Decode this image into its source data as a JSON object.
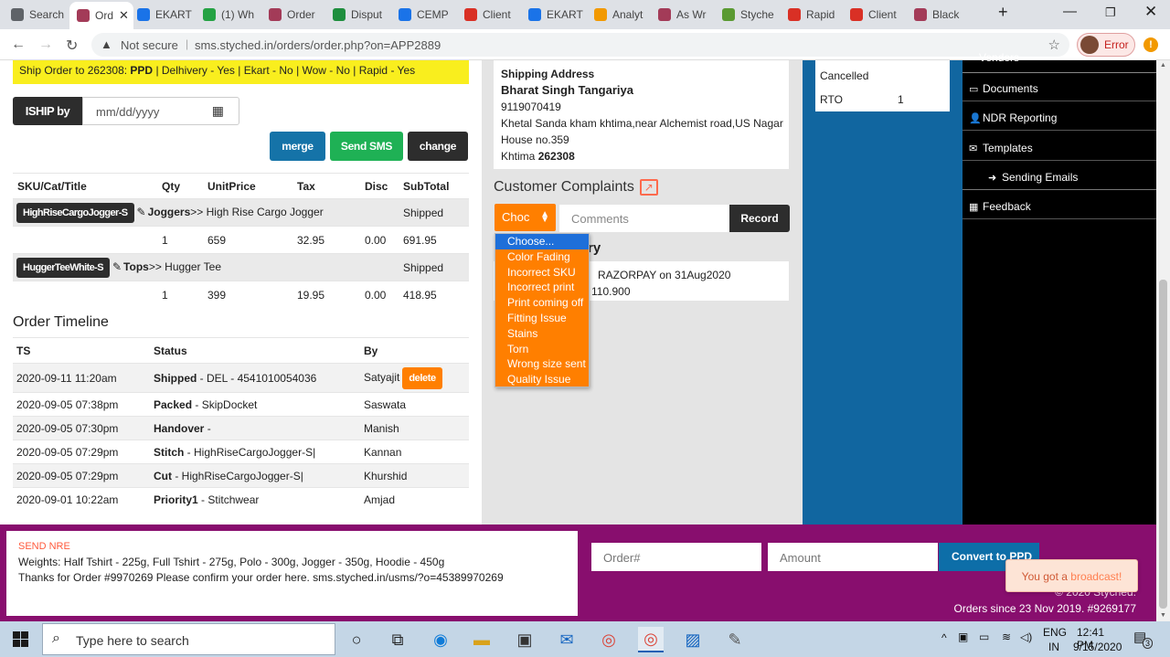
{
  "browser": {
    "tabs": [
      {
        "label": "Search",
        "color": "#5f6368"
      },
      {
        "label": "Ord",
        "color": "#a33b58",
        "active": true
      },
      {
        "label": "EKART",
        "color": "#1a73e8"
      },
      {
        "label": "(1) Wh",
        "color": "#25a244"
      },
      {
        "label": "Order",
        "color": "#a33b58"
      },
      {
        "label": "Disput",
        "color": "#1e8e3e"
      },
      {
        "label": "CEMP",
        "color": "#1a73e8"
      },
      {
        "label": "Client",
        "color": "#d93025"
      },
      {
        "label": "EKART",
        "color": "#1a73e8"
      },
      {
        "label": "Analyt",
        "color": "#f29900"
      },
      {
        "label": "As Wr",
        "color": "#a33b58"
      },
      {
        "label": "Styche",
        "color": "#5a9a32"
      },
      {
        "label": "Rapid",
        "color": "#d93025"
      },
      {
        "label": "Client",
        "color": "#d93025"
      },
      {
        "label": "Black",
        "color": "#a33b58"
      }
    ],
    "not_secure": "Not secure",
    "url": "sms.styched.in/orders/order.php?on=APP2889",
    "profile_status": "Error"
  },
  "order": {
    "ship_banner": {
      "prefix": "Ship Order to 262308: ",
      "bold": "PPD",
      "rest": " | Delhivery - Yes | Ekart - No | Wow - No | Rapid - Yes"
    },
    "ship_by_label": "ISHIP by",
    "date_placeholder": "mm/dd/yyyy",
    "buttons": {
      "merge": "merge",
      "send_sms": "Send SMS",
      "change": "change"
    },
    "sku_headers": [
      "SKU/Cat/Title",
      "Qty",
      "UnitPrice",
      "Tax",
      "Disc",
      "SubTotal"
    ],
    "items": [
      {
        "sku": "HighRiseCargoJogger-S",
        "cat": "Joggers",
        "sep": ">>",
        "title": " High Rise Cargo Jogger",
        "status": "Shipped",
        "qty": "1",
        "unit_price": "659",
        "tax": "32.95",
        "disc": "0.00",
        "subtotal": "691.95"
      },
      {
        "sku": "HuggerTeeWhite-S",
        "cat": "Tops",
        "sep": ">>",
        "title": " Hugger Tee",
        "status": "Shipped",
        "qty": "1",
        "unit_price": "399",
        "tax": "19.95",
        "disc": "0.00",
        "subtotal": "418.95"
      }
    ],
    "timeline_title": "Order Timeline",
    "timeline_headers": [
      "TS",
      "Status",
      "By"
    ],
    "timeline": [
      {
        "ts": "2020-09-11 11:20am",
        "status": "Shipped",
        "detail": " - DEL - 4541010054036",
        "by": "Satyajit",
        "action": "delete"
      },
      {
        "ts": "2020-09-05 07:38pm",
        "status": "Packed",
        "detail": " - SkipDocket",
        "by": "Saswata"
      },
      {
        "ts": "2020-09-05 07:30pm",
        "status": "Handover",
        "detail": " -",
        "by": "Manish"
      },
      {
        "ts": "2020-09-05 07:29pm",
        "status": "Stitch",
        "detail": " - HighRiseCargoJogger-S|",
        "by": "Kannan"
      },
      {
        "ts": "2020-09-05 07:29pm",
        "status": "Cut",
        "detail": " - HighRiseCargoJogger-S|",
        "by": "Khurshid"
      },
      {
        "ts": "2020-09-01 10:22am",
        "status": "Priority1",
        "detail": " - Stitchwear",
        "by": "Amjad"
      }
    ]
  },
  "shipping": {
    "heading": "Shipping Address",
    "name": "Bharat Singh Tangariya",
    "phone": "9119070419",
    "line1": "Khetal Sanda kham khtima,near Alchemist road,US Nagar",
    "line2": "House no.359",
    "city": "Khtima",
    "pin": "262308"
  },
  "complaints": {
    "title": "Customer Complaints",
    "select_value": "Choc",
    "comments_placeholder": "Comments",
    "record_label": "Record",
    "options": [
      "Choose...",
      "Color Fading",
      "Incorrect SKU",
      "Incorrect print",
      "Print coming off",
      "Fitting Issue",
      "Stains",
      "Torn",
      "Wrong size sent",
      "Quality Issue"
    ],
    "history_fragment": "ry"
  },
  "payment": {
    "line1": "RAZORPAY on 31Aug2020",
    "line2": "110.900"
  },
  "status_counts": [
    {
      "label": "Cancelled",
      "value": ""
    },
    {
      "label": "RTO",
      "value": "1"
    }
  ],
  "sidebar": {
    "partial_top": "Vendors",
    "items": [
      {
        "label": "Documents",
        "icon": "documents-icon"
      },
      {
        "label": "NDR Reporting",
        "icon": "user-icon"
      },
      {
        "label": "Templates",
        "icon": "mail-icon"
      },
      {
        "label": "Sending Emails",
        "icon": "arrow-right-icon"
      },
      {
        "label": "Feedback",
        "icon": "table-icon"
      }
    ]
  },
  "footer": {
    "sms_label": "SEND NRE",
    "sms_line1": "Weights: Half Tshirt - 225g, Full Tshirt - 275g, Polo - 300g, Jogger - 350g, Hoodie - 450g",
    "sms_line2": "Thanks for Order #9970269 Please confirm your order here. sms.styched.in/usms/?o=45389970269",
    "order_placeholder": "Order#",
    "amount_placeholder": "Amount",
    "convert_label": "Convert to PPD",
    "copyright": "© 2020 Styched.",
    "orders_since": "Orders since 23 Nov 2019. #9269177"
  },
  "toast": {
    "prefix": "You got a ",
    "link": "broadcast!"
  },
  "taskbar": {
    "search_placeholder": "Type here to search",
    "lang1": "ENG",
    "lang2": "IN",
    "time": "12:41 PM",
    "date": "9/15/2020",
    "notifications": "3"
  }
}
